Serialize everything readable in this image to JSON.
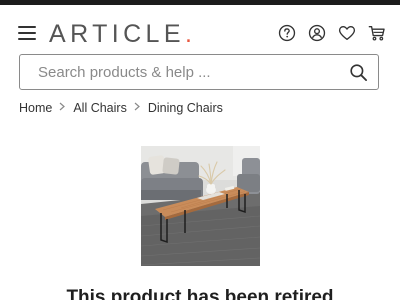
{
  "header": {
    "logo_text": "ARTICLE",
    "logo_dot": ".",
    "icons": [
      "menu-icon",
      "help-icon",
      "account-icon",
      "heart-icon",
      "cart-icon"
    ]
  },
  "search": {
    "placeholder": "Search products & help ..."
  },
  "breadcrumb": {
    "items": [
      "Home",
      "All Chairs",
      "Dining Chairs"
    ]
  },
  "product": {
    "notice": "This product has been retired"
  },
  "colors": {
    "brand_dot": "#e8573f",
    "logo_text": "#555555",
    "text": "#222222"
  }
}
